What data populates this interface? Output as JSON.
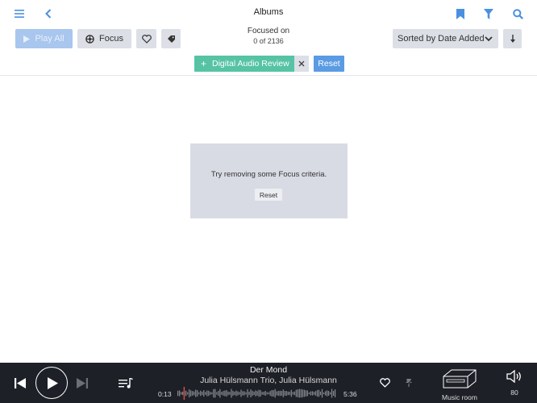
{
  "header": {
    "title": "Albums"
  },
  "toolbar": {
    "play_all": "Play All",
    "focus": "Focus",
    "focused_on_label": "Focused on",
    "focused_count": "0 of 2136",
    "sort_label": "Sorted by Date Added"
  },
  "filter": {
    "chip_label": "Digital Audio Review",
    "reset": "Reset"
  },
  "empty_state": {
    "message": "Try removing some Focus criteria.",
    "reset": "Reset"
  },
  "player": {
    "track_title": "Der Mond",
    "artist": "Julia Hülsmann Trio, Julia Hülsmann",
    "elapsed": "0:13",
    "duration": "5:36",
    "progress": 0.039,
    "zone": "Music room",
    "volume": "80"
  },
  "colors": {
    "accent": "#4a90e2",
    "chip": "#56c3a4",
    "player_bg": "#1e2027"
  }
}
